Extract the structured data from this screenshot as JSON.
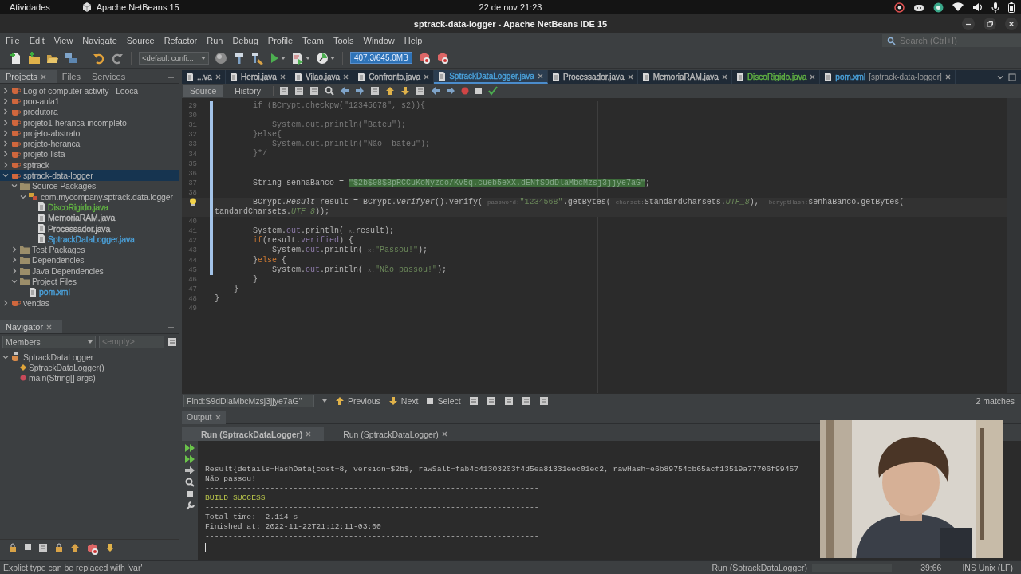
{
  "top_bar": {
    "activities": "Atividades",
    "app": "Apache NetBeans 15",
    "clock": "22 de nov  21:23"
  },
  "window": {
    "title": "sptrack-data-logger - Apache NetBeans IDE 15"
  },
  "menu": [
    "File",
    "Edit",
    "View",
    "Navigate",
    "Source",
    "Refactor",
    "Run",
    "Debug",
    "Profile",
    "Team",
    "Tools",
    "Window",
    "Help"
  ],
  "search": {
    "placeholder": "Search (Ctrl+I)"
  },
  "toolbar": {
    "configuration": "<default confi...",
    "memory": "407.3/645.0MB"
  },
  "projects": {
    "tabs": [
      {
        "label": "Projects",
        "selected": true
      },
      {
        "label": "Files",
        "selected": false
      },
      {
        "label": "Services",
        "selected": false
      }
    ],
    "tree": [
      {
        "label": "Log of computer activity - Looca",
        "kind": "project",
        "expanded": false,
        "selected": false
      },
      {
        "label": "poo-aula1",
        "kind": "project",
        "expanded": false,
        "selected": false
      },
      {
        "label": "produtora",
        "kind": "project",
        "expanded": false,
        "selected": false
      },
      {
        "label": "projeto1-heranca-incompleto",
        "kind": "project",
        "expanded": false,
        "selected": false
      },
      {
        "label": "projeto-abstrato",
        "kind": "project",
        "expanded": false,
        "selected": false
      },
      {
        "label": "projeto-heranca",
        "kind": "project",
        "expanded": false,
        "selected": false
      },
      {
        "label": "projeto-lista",
        "kind": "project",
        "expanded": false,
        "selected": false
      },
      {
        "label": "sptrack",
        "kind": "project",
        "expanded": false,
        "selected": false
      },
      {
        "label": "sptrack-data-logger",
        "kind": "project",
        "expanded": true,
        "selected": true,
        "children": [
          {
            "label": "Source Packages",
            "kind": "folder",
            "expanded": true,
            "selected": false,
            "children": [
              {
                "label": "com.mycompany.sptrack.data.logger",
                "kind": "package",
                "expanded": true,
                "selected": false,
                "children": [
                  {
                    "label": "DiscoRigido.java",
                    "kind": "file",
                    "color": "#62b543",
                    "selected": false
                  },
                  {
                    "label": "MemoriaRAM.java",
                    "kind": "file",
                    "color": "#bbbbbb",
                    "selected": false
                  },
                  {
                    "label": "Processador.java",
                    "kind": "file",
                    "color": "#bbbbbb",
                    "selected": false
                  },
                  {
                    "label": "SptrackDataLogger.java",
                    "kind": "file",
                    "color": "#4ba3dd",
                    "selected": false
                  }
                ]
              }
            ]
          },
          {
            "label": "Test Packages",
            "kind": "folder",
            "expanded": false,
            "selected": false
          },
          {
            "label": "Dependencies",
            "kind": "folder",
            "expanded": false,
            "selected": false
          },
          {
            "label": "Java Dependencies",
            "kind": "folder",
            "expanded": false,
            "selected": false
          },
          {
            "label": "Project Files",
            "kind": "folder",
            "expanded": true,
            "selected": false,
            "children": [
              {
                "label": "pom.xml",
                "kind": "file",
                "color": "#4ba3dd",
                "selected": false
              }
            ]
          }
        ]
      },
      {
        "label": "vendas",
        "kind": "project",
        "expanded": false,
        "selected": false
      }
    ]
  },
  "navigator": {
    "title": "Navigator",
    "filter": "Members",
    "placeholder": "<empty>",
    "tree": [
      {
        "label": "SptrackDataLogger",
        "kind": "class",
        "expanded": true,
        "children": [
          {
            "label": "SptrackDataLogger()",
            "kind": "constructor"
          },
          {
            "label": "main(String[] args)",
            "kind": "method"
          }
        ]
      }
    ]
  },
  "editor": {
    "tabs": [
      {
        "label": "...va",
        "color": "#bbbbbb",
        "selected": false
      },
      {
        "label": "Heroi.java",
        "color": "#bbbbbb",
        "selected": false
      },
      {
        "label": "Vilao.java",
        "color": "#bbbbbb",
        "selected": false
      },
      {
        "label": "Confronto.java",
        "color": "#bbbbbb",
        "selected": false
      },
      {
        "label": "SptrackDataLogger.java",
        "color": "#4ba3dd",
        "selected": true
      },
      {
        "label": "Processador.java",
        "color": "#bbbbbb",
        "selected": false
      },
      {
        "label": "MemoriaRAM.java",
        "color": "#bbbbbb",
        "selected": false
      },
      {
        "label": "DiscoRigido.java",
        "color": "#62b543",
        "selected": false
      },
      {
        "label": "pom.xml",
        "context": "[sptrack-data-logger]",
        "color": "#4ba3dd",
        "selected": false
      }
    ],
    "views": [
      {
        "label": "Source",
        "selected": true
      },
      {
        "label": "History",
        "selected": false
      }
    ],
    "lines": [
      {
        "number": "29",
        "changed": true,
        "segments": [
          {
            "kind": "comment",
            "text": "        if (BCrypt.checkpw(\"12345678\", s2)){"
          }
        ]
      },
      {
        "number": "30",
        "changed": true
      },
      {
        "number": "31",
        "changed": true,
        "segments": [
          {
            "kind": "comment",
            "text": "            System.out.println(\"Bateu\");"
          }
        ]
      },
      {
        "number": "32",
        "changed": true,
        "segments": [
          {
            "kind": "comment",
            "text": "        }else{"
          }
        ]
      },
      {
        "number": "33",
        "changed": true,
        "segments": [
          {
            "kind": "comment",
            "text": "            System.out.println(\"Não  bateu\");"
          }
        ]
      },
      {
        "number": "34",
        "changed": true,
        "segments": [
          {
            "kind": "comment",
            "text": "        }*/"
          }
        ]
      },
      {
        "number": "35",
        "changed": true
      },
      {
        "number": "36",
        "changed": true
      },
      {
        "number": "37",
        "changed": true,
        "segments": [
          {
            "kind": "plain",
            "text": "        String senhaBanco = "
          },
          {
            "kind": "match",
            "text": "\"$2b$08$8pRCCuKoNyzco/Kv5q.cueb5eXX.dENfS9dDlaMbcMzsj3jjye7aG\""
          },
          {
            "kind": "plain",
            "text": ";"
          }
        ]
      },
      {
        "number": "38",
        "changed": true
      },
      {
        "bulb": true,
        "current": true,
        "changed": true,
        "segments": [
          {
            "kind": "plain",
            "text": "        BCrypt."
          },
          {
            "kind": "italic",
            "text": "Result"
          },
          {
            "kind": "plain",
            "text": " result = BCrypt."
          },
          {
            "kind": "italic",
            "text": "verifyer"
          },
          {
            "kind": "plain",
            "text": "().verify( "
          },
          {
            "kind": "hint",
            "text": "password:"
          },
          {
            "kind": "string",
            "text": "\"1234568\""
          },
          {
            "kind": "plain",
            "text": ".getBytes( "
          },
          {
            "kind": "hint",
            "text": "charset:"
          },
          {
            "kind": "plain",
            "text": "StandardCharsets."
          },
          {
            "kind": "constant",
            "text": "UTF_8"
          },
          {
            "kind": "plain",
            "text": "),  "
          },
          {
            "kind": "hint",
            "text": "bcryptHash:"
          },
          {
            "kind": "plain",
            "text": "senhaBanco.getBytes("
          }
        ],
        "continuation": [
          {
            "kind": "plain",
            "text": "tandardCharsets."
          },
          {
            "kind": "constant",
            "text": "UTF_8"
          },
          {
            "kind": "plain",
            "text": "));"
          }
        ]
      },
      {
        "number": "40",
        "changed": true
      },
      {
        "number": "41",
        "changed": true,
        "segments": [
          {
            "kind": "plain",
            "text": "        System."
          },
          {
            "kind": "field",
            "text": "out"
          },
          {
            "kind": "plain",
            "text": ".println( "
          },
          {
            "kind": "hint",
            "text": "x:"
          },
          {
            "kind": "plain",
            "text": "result);"
          }
        ]
      },
      {
        "number": "42",
        "changed": true,
        "segments": [
          {
            "kind": "keyword",
            "text": "        if"
          },
          {
            "kind": "plain",
            "text": "(result."
          },
          {
            "kind": "field",
            "text": "verified"
          },
          {
            "kind": "plain",
            "text": ") {"
          }
        ]
      },
      {
        "number": "43",
        "changed": true,
        "segments": [
          {
            "kind": "plain",
            "text": "            System."
          },
          {
            "kind": "field",
            "text": "out"
          },
          {
            "kind": "plain",
            "text": ".println( "
          },
          {
            "kind": "hint",
            "text": "x:"
          },
          {
            "kind": "string",
            "text": "\"Passou!\""
          },
          {
            "kind": "plain",
            "text": ");"
          }
        ]
      },
      {
        "number": "44",
        "changed": true,
        "segments": [
          {
            "kind": "plain",
            "text": "        }"
          },
          {
            "kind": "keyword",
            "text": "else"
          },
          {
            "kind": "plain",
            "text": " {"
          }
        ]
      },
      {
        "number": "45",
        "changed": true,
        "segments": [
          {
            "kind": "plain",
            "text": "            System."
          },
          {
            "kind": "field",
            "text": "out"
          },
          {
            "kind": "plain",
            "text": ".println( "
          },
          {
            "kind": "hint",
            "text": "x:"
          },
          {
            "kind": "string",
            "text": "\"Não passou!\""
          },
          {
            "kind": "plain",
            "text": ");"
          }
        ]
      },
      {
        "number": "46",
        "changed": false,
        "segments": [
          {
            "kind": "plain",
            "text": "        }"
          }
        ]
      },
      {
        "number": "47",
        "changed": false,
        "segments": [
          {
            "kind": "plain",
            "text": "    }"
          }
        ]
      },
      {
        "number": "48",
        "changed": false,
        "segments": [
          {
            "kind": "plain",
            "text": "}"
          }
        ]
      },
      {
        "number": "49",
        "changed": false
      }
    ]
  },
  "find_bar": {
    "label": "Find:",
    "value": "S9dDlaMbcMzsj3jjye7aG\"",
    "buttons": [
      "Previous",
      "Next",
      "Select"
    ],
    "matches": "2 matches"
  },
  "output": {
    "title": "Output",
    "tabs": [
      {
        "label": "Run (SptrackDataLogger)",
        "selected": true
      },
      {
        "label": "Run (SptrackDataLogger)",
        "selected": false
      }
    ],
    "lines": [
      {
        "kind": "plain",
        "text": "Result{details=HashData{cost=8, version=$2b$, rawSalt=fab4c41303203f4d5ea81331eec01ec2, rawHash=e6b89754cb65acf13519a77706f99457"
      },
      {
        "kind": "plain",
        "text": "Não passou!"
      },
      {
        "kind": "plain",
        "text": "------------------------------------------------------------------------"
      },
      {
        "kind": "success",
        "text": "BUILD SUCCESS"
      },
      {
        "kind": "plain",
        "text": "------------------------------------------------------------------------"
      },
      {
        "kind": "plain",
        "text": "Total time:  2.114 s"
      },
      {
        "kind": "plain",
        "text": "Finished at: 2022-11-22T21:12:11-03:00"
      },
      {
        "kind": "plain",
        "text": "------------------------------------------------------------------------"
      }
    ]
  },
  "status_bar": {
    "message": "Explict type can be replaced with 'var'",
    "task": "Run (SptrackDataLogger)",
    "position": "39:66",
    "mode": "INS Unix (LF)"
  },
  "webcam": {
    "kind": "picture"
  }
}
